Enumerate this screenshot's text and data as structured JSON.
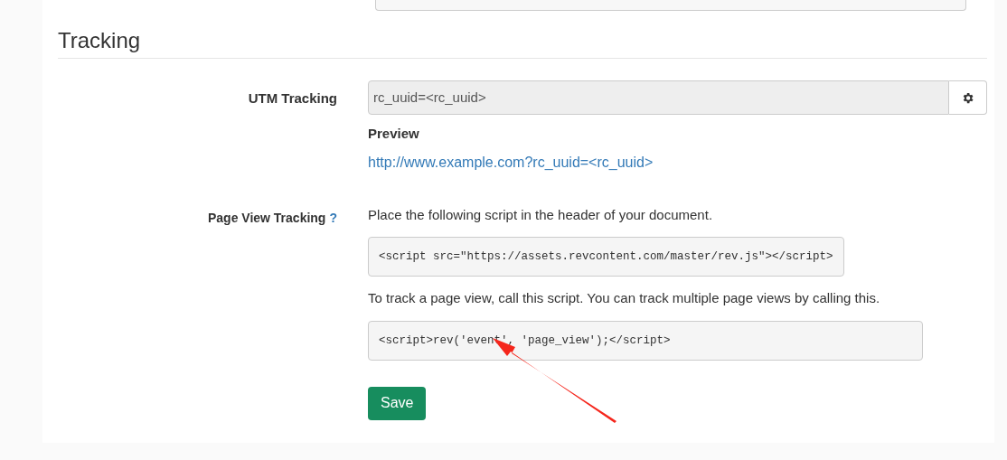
{
  "section": {
    "title": "Tracking"
  },
  "utm": {
    "label": "UTM Tracking",
    "value": "rc_uuid=<rc_uuid>",
    "disabled": true,
    "preview_label": "Preview",
    "preview_link": "http://www.example.com?rc_uuid=<rc_uuid>"
  },
  "page_view": {
    "label": "Page View Tracking",
    "help": "?",
    "instruction_1": "Place the following script in the header of your document.",
    "code_1": "<script src=\"https://assets.revcontent.com/master/rev.js\"></script>",
    "instruction_2": "To track a page view, call this script. You can track multiple page views by calling this.",
    "code_2": "<script>rev('event', 'page_view');</script>"
  },
  "save_button": "Save"
}
